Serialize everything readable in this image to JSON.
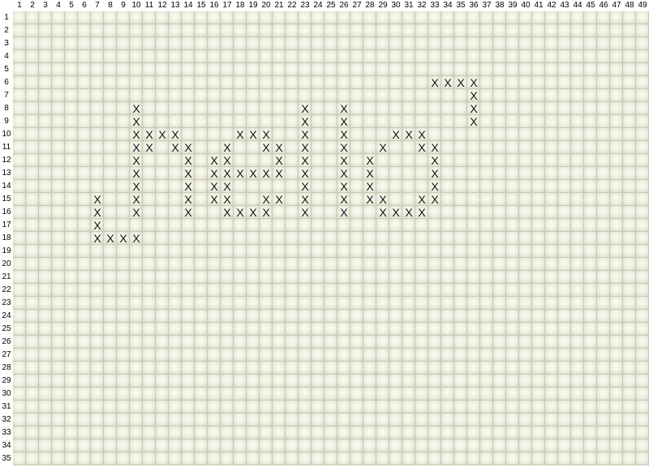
{
  "grid": {
    "columns": 49,
    "rows": 35,
    "col_labels": [
      "1",
      "2",
      "3",
      "4",
      "5",
      "6",
      "7",
      "8",
      "9",
      "10",
      "11",
      "12",
      "13",
      "14",
      "15",
      "16",
      "17",
      "18",
      "19",
      "20",
      "21",
      "22",
      "23",
      "24",
      "25",
      "26",
      "27",
      "28",
      "29",
      "30",
      "31",
      "32",
      "33",
      "34",
      "35",
      "36",
      "37",
      "38",
      "39",
      "40",
      "41",
      "42",
      "43",
      "44",
      "45",
      "46",
      "47",
      "48",
      "49"
    ],
    "row_labels": [
      "1",
      "2",
      "3",
      "4",
      "5",
      "6",
      "7",
      "8",
      "9",
      "10",
      "11",
      "12",
      "13",
      "14",
      "15",
      "16",
      "17",
      "18",
      "19",
      "20",
      "21",
      "22",
      "23",
      "24",
      "25",
      "26",
      "27",
      "28",
      "29",
      "30",
      "31",
      "32",
      "33",
      "34",
      "35"
    ],
    "mark_glyph": "X",
    "marks": [
      [
        6,
        33
      ],
      [
        6,
        34
      ],
      [
        6,
        35
      ],
      [
        6,
        36
      ],
      [
        7,
        36
      ],
      [
        8,
        36
      ],
      [
        9,
        36
      ],
      [
        8,
        10
      ],
      [
        8,
        23
      ],
      [
        8,
        26
      ],
      [
        9,
        10
      ],
      [
        9,
        23
      ],
      [
        9,
        26
      ],
      [
        10,
        10
      ],
      [
        10,
        11
      ],
      [
        10,
        12
      ],
      [
        10,
        13
      ],
      [
        10,
        18
      ],
      [
        10,
        19
      ],
      [
        10,
        20
      ],
      [
        10,
        23
      ],
      [
        10,
        26
      ],
      [
        10,
        30
      ],
      [
        10,
        31
      ],
      [
        10,
        32
      ],
      [
        11,
        10
      ],
      [
        11,
        11
      ],
      [
        11,
        13
      ],
      [
        11,
        14
      ],
      [
        11,
        17
      ],
      [
        11,
        20
      ],
      [
        11,
        21
      ],
      [
        11,
        23
      ],
      [
        11,
        26
      ],
      [
        11,
        29
      ],
      [
        11,
        32
      ],
      [
        11,
        33
      ],
      [
        12,
        10
      ],
      [
        12,
        14
      ],
      [
        12,
        16
      ],
      [
        12,
        17
      ],
      [
        12,
        21
      ],
      [
        12,
        23
      ],
      [
        12,
        26
      ],
      [
        12,
        28
      ],
      [
        12,
        33
      ],
      [
        13,
        10
      ],
      [
        13,
        14
      ],
      [
        13,
        16
      ],
      [
        13,
        17
      ],
      [
        13,
        18
      ],
      [
        13,
        19
      ],
      [
        13,
        20
      ],
      [
        13,
        21
      ],
      [
        13,
        23
      ],
      [
        13,
        26
      ],
      [
        13,
        28
      ],
      [
        13,
        33
      ],
      [
        14,
        10
      ],
      [
        14,
        14
      ],
      [
        14,
        16
      ],
      [
        14,
        17
      ],
      [
        14,
        23
      ],
      [
        14,
        26
      ],
      [
        14,
        28
      ],
      [
        14,
        33
      ],
      [
        15,
        7
      ],
      [
        15,
        10
      ],
      [
        15,
        14
      ],
      [
        15,
        16
      ],
      [
        15,
        17
      ],
      [
        15,
        20
      ],
      [
        15,
        21
      ],
      [
        15,
        23
      ],
      [
        15,
        26
      ],
      [
        15,
        28
      ],
      [
        15,
        29
      ],
      [
        15,
        32
      ],
      [
        15,
        33
      ],
      [
        16,
        7
      ],
      [
        16,
        10
      ],
      [
        16,
        14
      ],
      [
        16,
        17
      ],
      [
        16,
        18
      ],
      [
        16,
        19
      ],
      [
        16,
        20
      ],
      [
        16,
        23
      ],
      [
        16,
        26
      ],
      [
        16,
        29
      ],
      [
        16,
        30
      ],
      [
        16,
        31
      ],
      [
        16,
        32
      ],
      [
        17,
        7
      ],
      [
        18,
        7
      ],
      [
        18,
        8
      ],
      [
        18,
        9
      ],
      [
        18,
        10
      ]
    ]
  }
}
